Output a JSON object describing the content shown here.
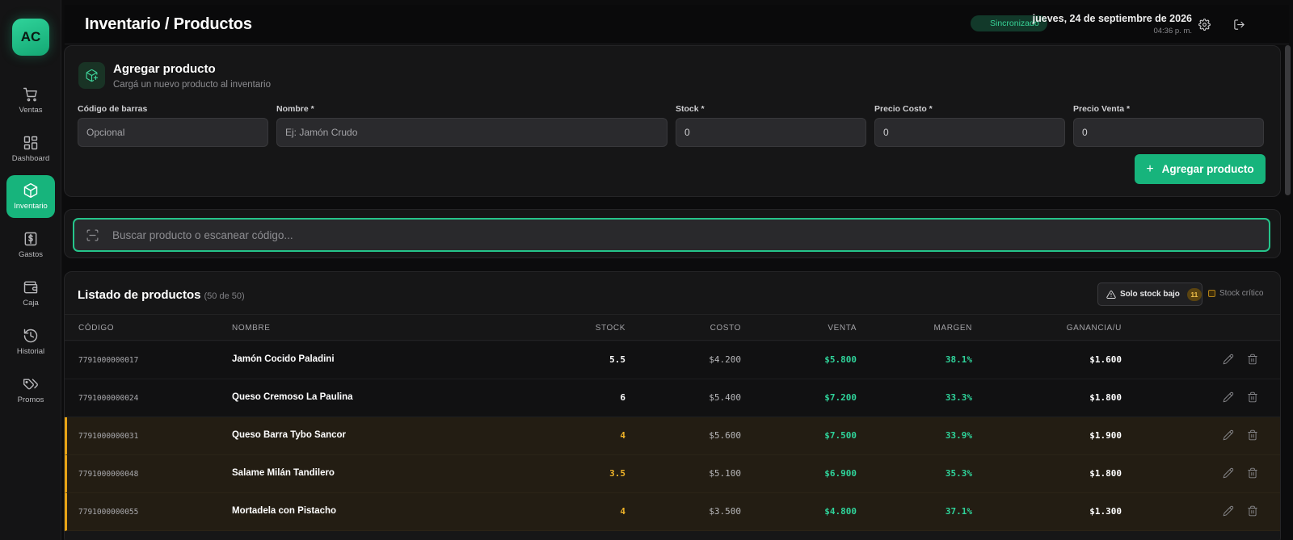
{
  "sidebar": {
    "logo": "AC",
    "items": [
      {
        "label": "Ventas",
        "icon": "cart-icon"
      },
      {
        "label": "Dashboard",
        "icon": "dashboard-icon"
      },
      {
        "label": "Inventario",
        "icon": "box-icon"
      },
      {
        "label": "Gastos",
        "icon": "dollar-icon"
      },
      {
        "label": "Caja",
        "icon": "wallet-icon"
      },
      {
        "label": "Historial",
        "icon": "history-icon"
      },
      {
        "label": "Promos",
        "icon": "tags-icon"
      }
    ],
    "active": "Inventario"
  },
  "header": {
    "title": "Inventario / Productos",
    "sync_status": "Sincronizado",
    "date": "jueves, 24 de septiembre de 2026",
    "time": "04:36 p. m."
  },
  "add_form": {
    "title": "Agregar producto",
    "subtitle": "Cargá un nuevo producto al inventario",
    "fields": {
      "barcode": {
        "label": "Código de barras",
        "placeholder": "Opcional"
      },
      "name": {
        "label": "Nombre *",
        "placeholder": "Ej: Jamón Crudo"
      },
      "stock": {
        "label": "Stock *",
        "value": "0"
      },
      "cost": {
        "label": "Precio Costo *",
        "value": "0"
      },
      "price": {
        "label": "Precio Venta *",
        "value": "0"
      }
    },
    "submit_label": "Agregar producto"
  },
  "search": {
    "placeholder": "Buscar producto o escanear código..."
  },
  "list": {
    "title": "Listado de productos",
    "count": "(50 de 50)",
    "low_stock_button": "Solo stock bajo",
    "low_stock_count": "11",
    "critical_label": "Stock crítico",
    "columns": [
      "CÓDIGO",
      "NOMBRE",
      "STOCK",
      "COSTO",
      "VENTA",
      "MARGEN",
      "GANANCIA/U"
    ],
    "rows": [
      {
        "code": "7791000000017",
        "name": "Jamón Cocido Paladini",
        "stock": "5.5",
        "cost": "$4.200",
        "sale": "$5.800",
        "margin": "38.1%",
        "profit": "$1.600",
        "low": false
      },
      {
        "code": "7791000000024",
        "name": "Queso Cremoso La Paulina",
        "stock": "6",
        "cost": "$5.400",
        "sale": "$7.200",
        "margin": "33.3%",
        "profit": "$1.800",
        "low": false
      },
      {
        "code": "7791000000031",
        "name": "Queso Barra Tybo Sancor",
        "stock": "4",
        "cost": "$5.600",
        "sale": "$7.500",
        "margin": "33.9%",
        "profit": "$1.900",
        "low": true
      },
      {
        "code": "7791000000048",
        "name": "Salame Milán Tandilero",
        "stock": "3.5",
        "cost": "$5.100",
        "sale": "$6.900",
        "margin": "35.3%",
        "profit": "$1.800",
        "low": true
      },
      {
        "code": "7791000000055",
        "name": "Mortadela con Pistacho",
        "stock": "4",
        "cost": "$3.500",
        "sale": "$4.800",
        "margin": "37.1%",
        "profit": "$1.300",
        "low": true
      }
    ]
  },
  "colors": {
    "accent": "#17b47c",
    "warning": "#f0b429",
    "background": "#0c0c0d"
  }
}
